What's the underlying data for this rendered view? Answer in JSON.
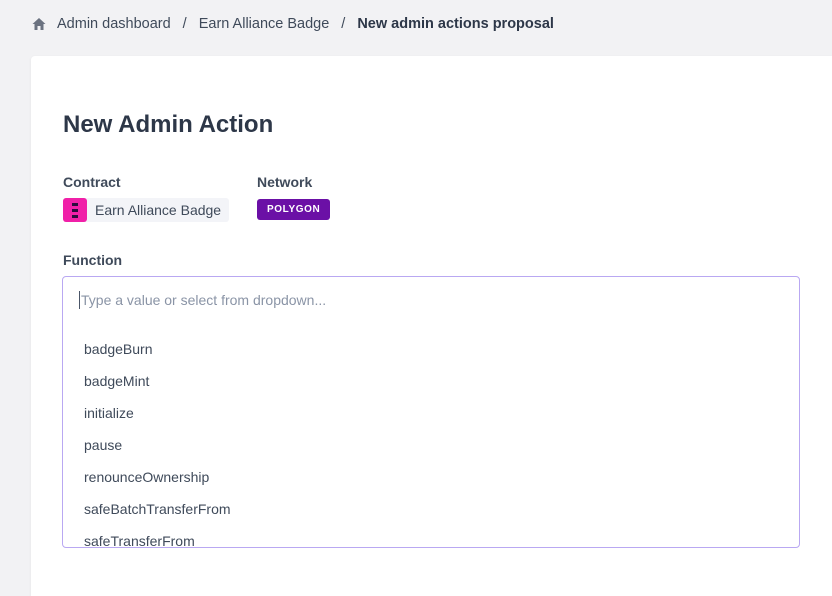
{
  "breadcrumb": {
    "items": [
      "Admin dashboard",
      "Earn Alliance Badge"
    ],
    "current": "New admin actions proposal",
    "separator": "/"
  },
  "page": {
    "title": "New Admin Action"
  },
  "contract": {
    "label": "Contract",
    "name": "Earn Alliance Badge",
    "logo_color": "#f020a8"
  },
  "network": {
    "label": "Network",
    "value": "POLYGON",
    "badge_color": "#6b10a6"
  },
  "function": {
    "label": "Function",
    "placeholder": "Type a value or select from dropdown...",
    "value": "",
    "options": [
      "badgeBurn",
      "badgeMint",
      "initialize",
      "pause",
      "renounceOwnership",
      "safeBatchTransferFrom",
      "safeTransferFrom"
    ]
  },
  "colors": {
    "accent_border": "#b9a8f2",
    "background": "#f2f2f4",
    "text": "#2d3748"
  }
}
